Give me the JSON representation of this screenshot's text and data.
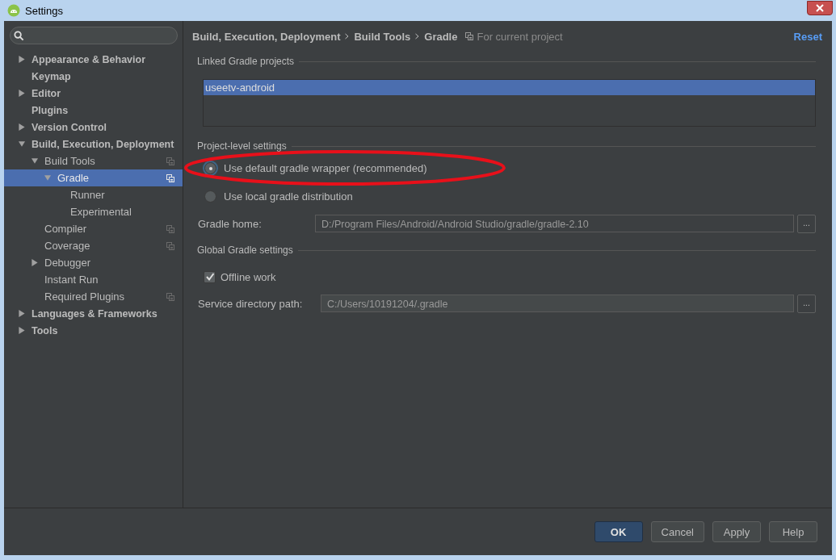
{
  "window": {
    "title": "Settings"
  },
  "sidebar": {
    "tree": [
      {
        "label": "Appearance & Behavior",
        "expanded": false,
        "selected": false,
        "project_scope": false
      },
      {
        "label": "Keymap",
        "selected": false,
        "project_scope": false
      },
      {
        "label": "Editor",
        "expanded": false,
        "selected": false,
        "project_scope": false
      },
      {
        "label": "Plugins",
        "selected": false,
        "project_scope": false
      },
      {
        "label": "Version Control",
        "expanded": false,
        "selected": false,
        "project_scope": false
      },
      {
        "label": "Build, Execution, Deployment",
        "expanded": true,
        "selected": false,
        "project_scope": false,
        "children": [
          {
            "label": "Build Tools",
            "expanded": true,
            "selected": false,
            "project_scope": true,
            "children": [
              {
                "label": "Gradle",
                "expanded": true,
                "selected": true,
                "project_scope": true,
                "children": [
                  {
                    "label": "Runner",
                    "selected": false,
                    "project_scope": false
                  },
                  {
                    "label": "Experimental",
                    "selected": false,
                    "project_scope": false
                  }
                ]
              }
            ]
          },
          {
            "label": "Compiler",
            "selected": false,
            "project_scope": true
          },
          {
            "label": "Coverage",
            "selected": false,
            "project_scope": true
          },
          {
            "label": "Debugger",
            "expanded": false,
            "selected": false,
            "project_scope": false
          },
          {
            "label": "Instant Run",
            "selected": false,
            "project_scope": false
          },
          {
            "label": "Required Plugins",
            "selected": false,
            "project_scope": true
          }
        ]
      },
      {
        "label": "Languages & Frameworks",
        "expanded": false,
        "selected": false,
        "project_scope": false
      },
      {
        "label": "Tools",
        "expanded": false,
        "selected": false,
        "project_scope": false
      }
    ]
  },
  "breadcrumbs": [
    "Build, Execution, Deployment",
    "Build Tools",
    "Gradle"
  ],
  "scope_note": "For current project",
  "reset": "Reset",
  "linked_projects": {
    "title": "Linked Gradle projects",
    "items": [
      {
        "label": "useetv-android",
        "selected": true
      }
    ]
  },
  "project_level": {
    "title": "Project-level settings",
    "options": [
      {
        "label": "Use default gradle wrapper (recommended)",
        "selected": true,
        "annotated": true
      },
      {
        "label": "Use local gradle distribution",
        "selected": false,
        "annotated": false
      }
    ],
    "gradle_home": {
      "label": "Gradle home:",
      "value": "D:/Program Files/Android/Android Studio/gradle/gradle-2.10",
      "browse": "..."
    }
  },
  "global": {
    "title": "Global Gradle settings",
    "offline": {
      "label": "Offline work",
      "checked": true
    },
    "service_dir": {
      "label": "Service directory path:",
      "value": "C:/Users/10191204/.gradle",
      "browse": "..."
    }
  },
  "buttons": [
    {
      "label": "OK",
      "default": true
    },
    {
      "label": "Cancel",
      "default": false
    },
    {
      "label": "Apply",
      "default": false
    },
    {
      "label": "Help",
      "default": false
    }
  ]
}
